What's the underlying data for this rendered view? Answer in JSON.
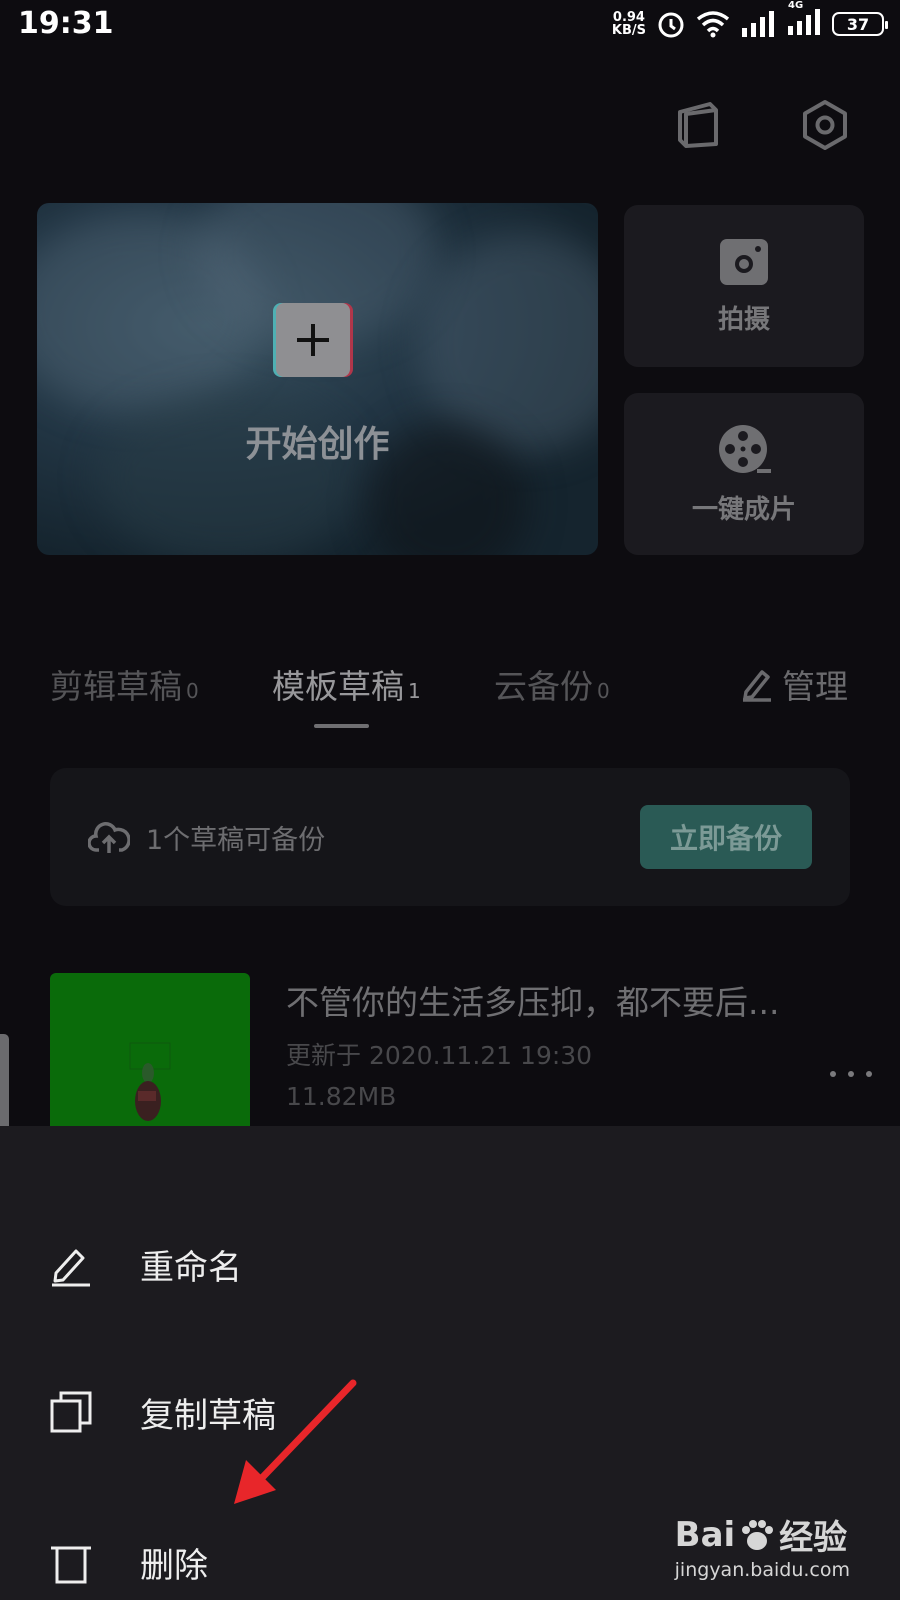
{
  "status_bar": {
    "time": "19:31",
    "net_speed_value": "0.94",
    "net_speed_unit": "KB/S",
    "network_type": "4G",
    "battery": "37"
  },
  "top_icons": [
    "book-icon",
    "settings-hex-icon"
  ],
  "create_card": {
    "label": "开始创作"
  },
  "side_cards": [
    {
      "label": "拍摄",
      "icon": "camera-icon"
    },
    {
      "label": "一键成片",
      "icon": "film-reel-icon"
    }
  ],
  "tabs": [
    {
      "label": "剪辑草稿",
      "count": "0",
      "active": false
    },
    {
      "label": "模板草稿",
      "count": "1",
      "active": true
    },
    {
      "label": "云备份",
      "count": "0",
      "active": false
    }
  ],
  "manage_label": "管理",
  "backup": {
    "text": "1个草稿可备份",
    "button": "立即备份"
  },
  "draft": {
    "title": "不管你的生活多压抑，都不要后...",
    "updated": "更新于 2020.11.21 19:30",
    "size": "11.82MB",
    "more": "..."
  },
  "sheet": {
    "items": [
      {
        "label": "重命名",
        "icon": "pencil-icon"
      },
      {
        "label": "复制草稿",
        "icon": "copy-icon"
      },
      {
        "label": "删除",
        "icon": "trash-icon"
      }
    ]
  },
  "watermark": {
    "brand_left": "Bai",
    "brand_right": "经验",
    "url": "jingyan.baidu.com"
  },
  "colors": {
    "background": "#0d0c10",
    "sheet": "#1c1b1f",
    "accent_button": "#2a5a55",
    "annotation_arrow": "#e8262a"
  }
}
